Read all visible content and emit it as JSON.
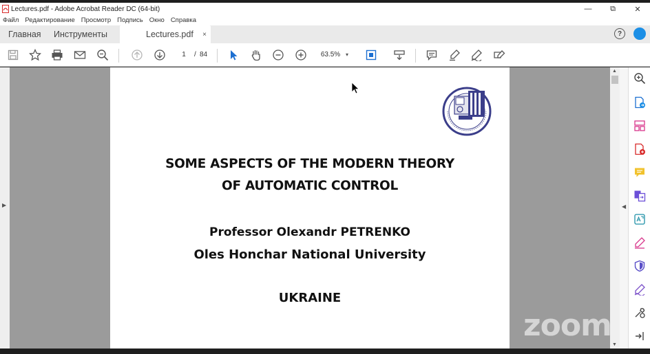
{
  "window": {
    "title": "Lectures.pdf - Adobe Acrobat Reader DC (64-bit)",
    "minimize": "—",
    "maximize": "⧉",
    "close": "✕"
  },
  "menu": [
    "Файл",
    "Редактирование",
    "Просмотр",
    "Подпись",
    "Окно",
    "Справка"
  ],
  "tabs": {
    "home": "Главная",
    "tools": "Инструменты",
    "document": "Lectures.pdf",
    "close": "×",
    "help": "?"
  },
  "toolbar": {
    "current_page": "1",
    "page_separator": "/",
    "total_pages": "84",
    "zoom": "63.5%",
    "zoom_dropdown": "▾"
  },
  "document": {
    "title_line1": "SOME ASPECTS OF THE MODERN THEORY",
    "title_line2": "OF AUTOMATIC CONTROL",
    "author": "Professor Olexandr PETRENKO",
    "university": "Oles Honchar National University",
    "country": "UKRAINE"
  },
  "watermark": "zoom",
  "colors": {
    "accent_blue": "#1c8fe6",
    "tool_icon_blue": "#1c6fd1",
    "acrobat_red": "#d82a2a",
    "page_bg": "#9b9b9b"
  },
  "icons": {
    "toolbar": [
      "save-icon",
      "bookmark-star-icon",
      "print-icon",
      "email-icon",
      "zoom-out-magnifier-icon",
      "page-up-icon",
      "page-down-icon",
      "select-arrow-icon",
      "hand-icon",
      "zoom-out-icon",
      "zoom-in-icon",
      "fit-page-icon",
      "scroll-mode-icon",
      "comment-icon",
      "highlight-icon",
      "draw-icon",
      "fill-sign-icon"
    ],
    "tools_pane": [
      "search-zoom-icon",
      "export-pdf-icon",
      "organize-pages-icon",
      "create-pdf-icon",
      "comment-icon",
      "combine-files-icon",
      "edit-pdf-icon",
      "fill-sign-icon",
      "protect-icon",
      "sign-icon",
      "more-tools-icon",
      "collapse-pane-icon"
    ]
  }
}
